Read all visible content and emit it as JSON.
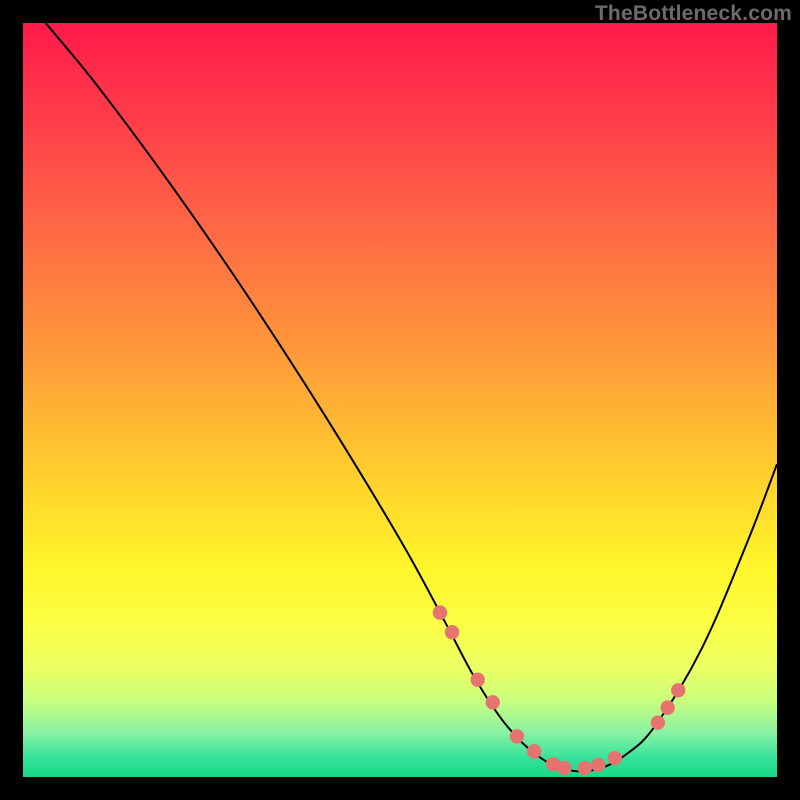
{
  "watermark": "TheBottleneck.com",
  "colors": {
    "background": "#000000",
    "curve_stroke": "#000000",
    "dot_fill": "#e6736f",
    "gradient_stops": [
      {
        "offset": 0.0,
        "color": "#ff1a4b"
      },
      {
        "offset": 0.12,
        "color": "#ff3b4a"
      },
      {
        "offset": 0.28,
        "color": "#ff6a45"
      },
      {
        "offset": 0.44,
        "color": "#ff9a3a"
      },
      {
        "offset": 0.6,
        "color": "#ffcf2e"
      },
      {
        "offset": 0.72,
        "color": "#fff52a"
      },
      {
        "offset": 0.8,
        "color": "#fbff46"
      },
      {
        "offset": 0.86,
        "color": "#eaff66"
      },
      {
        "offset": 0.9,
        "color": "#c7ff7e"
      },
      {
        "offset": 0.94,
        "color": "#8cf2a3"
      },
      {
        "offset": 0.975,
        "color": "#34e39a"
      },
      {
        "offset": 1.0,
        "color": "#18d884"
      }
    ]
  },
  "chart_data": {
    "type": "line",
    "title": "",
    "xlabel": "",
    "ylabel": "",
    "xlim": [
      0,
      100
    ],
    "ylim": [
      0,
      100
    ],
    "series": [
      {
        "name": "bottleneck-curve",
        "x": [
          3,
          10,
          20,
          30,
          40,
          50,
          56,
          60,
          64,
          68,
          72,
          76,
          80,
          84,
          90,
          96,
          100
        ],
        "values": [
          100,
          91.5,
          78,
          63.5,
          48,
          31.5,
          20.5,
          13,
          7,
          3,
          1,
          1,
          3,
          7,
          17,
          31,
          41.5
        ]
      }
    ],
    "dots": {
      "name": "highlight-dots",
      "x": [
        55.3,
        56.9,
        60.3,
        62.3,
        65.5,
        67.8,
        70.3,
        71.8,
        74.5,
        76.3,
        78.5,
        84.2,
        85.5,
        86.9
      ],
      "values": [
        21.8,
        19.2,
        12.9,
        9.9,
        5.4,
        3.4,
        1.7,
        1.2,
        1.2,
        1.6,
        2.5,
        7.2,
        9.2,
        11.5
      ]
    }
  }
}
